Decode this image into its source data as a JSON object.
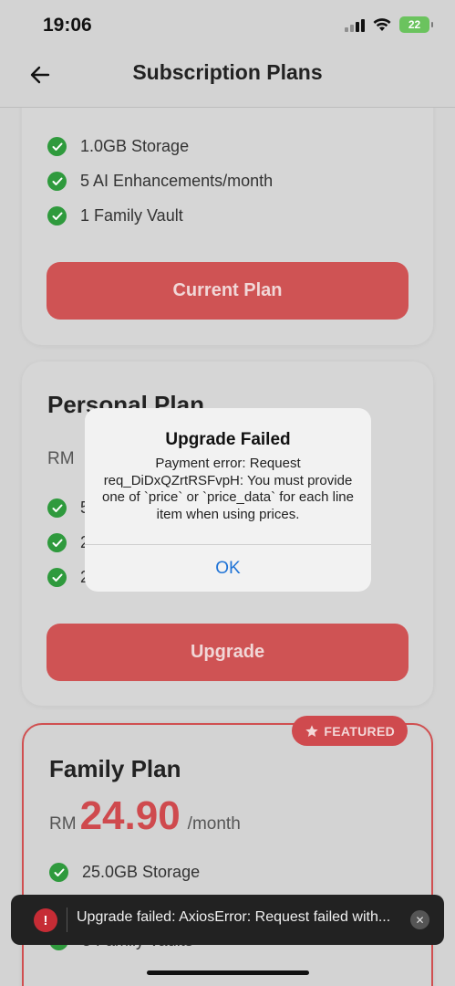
{
  "status_bar": {
    "time": "19:06",
    "battery_level": "22"
  },
  "header": {
    "title": "Subscription Plans"
  },
  "plans": {
    "free": {
      "features": [
        "1.0GB Storage",
        "5 AI Enhancements/month",
        "1 Family Vault"
      ],
      "button_label": "Current Plan"
    },
    "personal": {
      "name": "Personal Plan",
      "currency": "RM",
      "feature_fragments": [
        "5",
        "2",
        "2"
      ],
      "button_label": "Upgrade"
    },
    "family": {
      "badge": "FEATURED",
      "name": "Family Plan",
      "currency": "RM",
      "price": "24.90",
      "period": "/month",
      "features": [
        "25.0GB Storage",
        "5 Family Vaults"
      ]
    }
  },
  "dialog": {
    "title": "Upgrade Failed",
    "message": "Payment error: Request req_DiDxQZrtRSFvpH: You must provide one of `price` or `price_data` for each line item when using prices.",
    "ok_label": "OK"
  },
  "toast": {
    "message": "Upgrade failed: AxiosError: Request failed with..."
  },
  "colors": {
    "accent": "#cf4a4e",
    "success": "#2f9a3d",
    "link": "#1f73d6",
    "background": "#d3d3d3"
  }
}
